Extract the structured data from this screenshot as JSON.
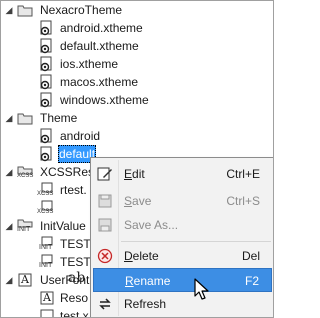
{
  "tree": {
    "nexacro_theme": {
      "label": "NexacroTheme",
      "children": [
        "android.xtheme",
        "default.xtheme",
        "ios.xtheme",
        "macos.xtheme",
        "windows.xtheme"
      ]
    },
    "theme": {
      "label": "Theme",
      "children": [
        "android",
        "default"
      ]
    },
    "xcss": {
      "label": "XCSSRes",
      "children": [
        "rtest.",
        ""
      ]
    },
    "initvalue": {
      "label": "InitValue",
      "children": [
        "TEST",
        "TEST"
      ]
    },
    "userfont": {
      "label": "UserFont",
      "children": [
        "Reso",
        "test.x"
      ]
    },
    "icon_labels": {
      "xcss": "XCSS",
      "init": "INIT",
      "font": "A"
    }
  },
  "context_menu": {
    "items": [
      {
        "label": "Edit",
        "mnemonic": "E",
        "shortcut": "Ctrl+E",
        "enabled": true,
        "icon": "edit-icon"
      },
      {
        "label": "Save",
        "mnemonic": "S",
        "shortcut": "Ctrl+S",
        "enabled": false,
        "icon": "save-icon"
      },
      {
        "label": "Save As...",
        "mnemonic": "",
        "shortcut": "",
        "enabled": false,
        "icon": "save-as-icon"
      },
      {
        "label": "Delete",
        "mnemonic": "D",
        "shortcut": "Del",
        "enabled": true,
        "icon": "delete-icon"
      },
      {
        "label": "Rename",
        "mnemonic": "R",
        "shortcut": "F2",
        "enabled": true,
        "icon": "rename-icon",
        "highlighted": true
      },
      {
        "label": "Refresh",
        "mnemonic": "",
        "shortcut": "",
        "enabled": true,
        "icon": "refresh-icon"
      }
    ],
    "rename_icon_text": "ab"
  },
  "colors": {
    "selection": "#3399ff",
    "menu_highlight": "#3d8ee4",
    "disabled_text": "#8c8c8c"
  }
}
